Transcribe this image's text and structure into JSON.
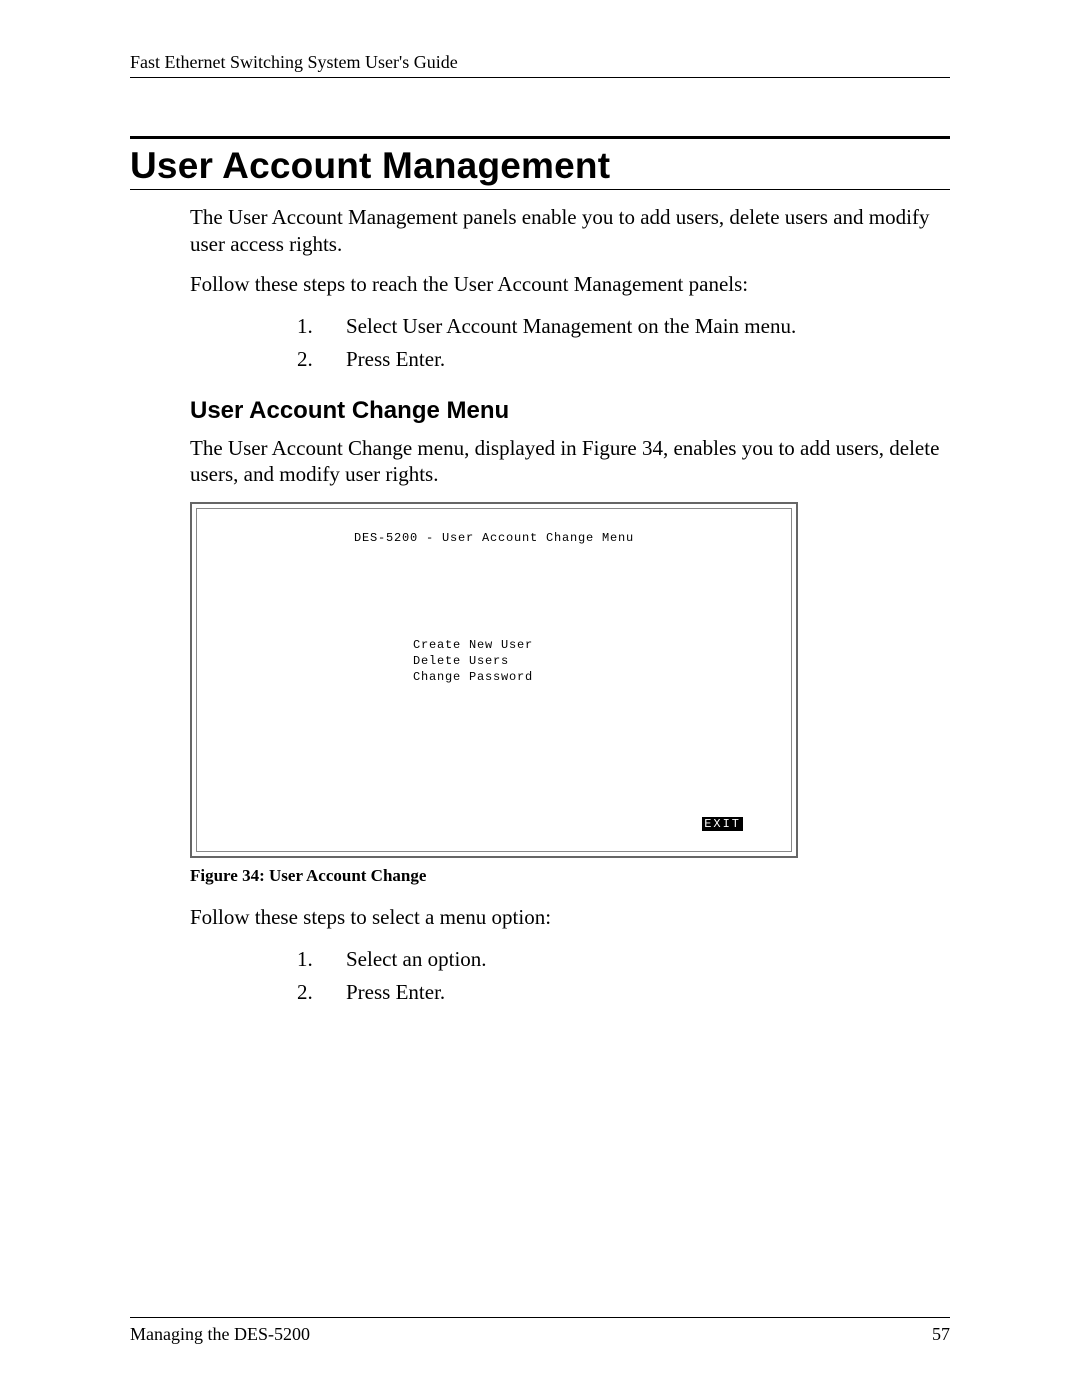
{
  "header": {
    "running_head": "Fast Ethernet Switching System User's Guide"
  },
  "section": {
    "title": "User Account Management",
    "intro": "The User Account Management panels enable you to add users, delete users and modify user access rights.",
    "lead_in": "Follow these steps to reach the User Account Management panels:",
    "steps": [
      "Select User Account Management on the Main menu.",
      "Press Enter."
    ]
  },
  "subsection": {
    "title": "User Account Change Menu",
    "intro": "The User Account Change menu, displayed in Figure 34, enables you to add users, delete users, and modify user rights."
  },
  "terminal": {
    "title": "DES-5200 - User Account Change Menu",
    "menu_items": [
      "Create New User",
      "Delete Users",
      "Change Password"
    ],
    "exit_label": "EXIT"
  },
  "figure_caption": "Figure 34: User Account Change",
  "post_figure": {
    "lead_in": "Follow these steps to select a menu option:",
    "steps": [
      "Select an option.",
      "Press Enter."
    ]
  },
  "footer": {
    "chapter": "Managing the DES-5200",
    "page_number": "57"
  }
}
